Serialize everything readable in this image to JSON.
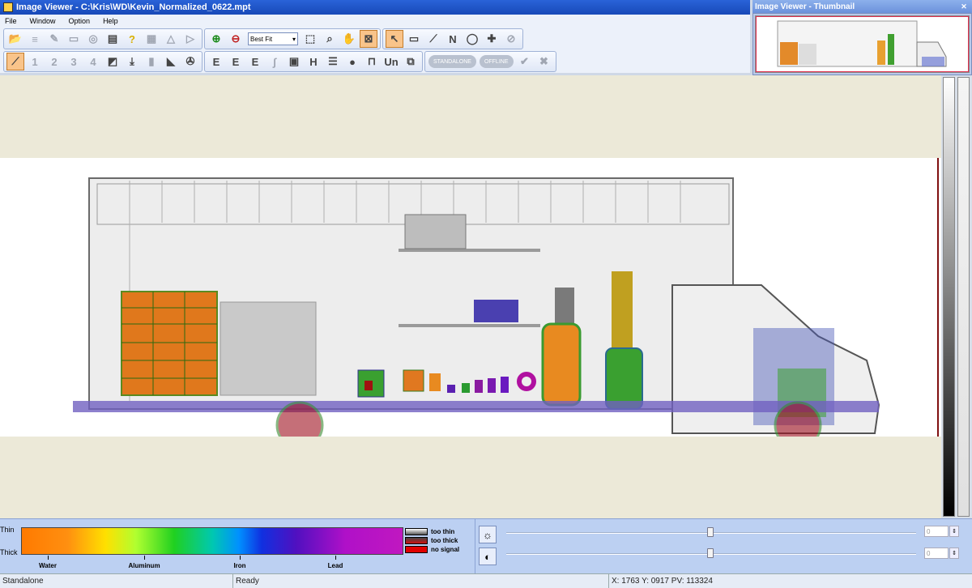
{
  "window": {
    "title": "Image Viewer - C:\\Kris\\WD\\Kevin_Normalized_0622.mpt",
    "thumb_title": "Image Viewer - Thumbnail"
  },
  "menu": [
    "File",
    "Window",
    "Option",
    "Help"
  ],
  "toolbar": {
    "zoom_select": "Best Fit",
    "standalone_label": "STANDALONE",
    "offline_label": "OFFLINE",
    "second_row_numbers": [
      "1",
      "2",
      "3",
      "4"
    ],
    "letter_buttons": [
      "N",
      "E",
      "E",
      "E",
      "H",
      "Un"
    ]
  },
  "legend": {
    "thin": "Thin",
    "thick": "Thick",
    "materials": [
      "Water",
      "Aluminum",
      "Iron",
      "Lead"
    ],
    "signals": [
      "too thin",
      "too thick",
      "no signal"
    ]
  },
  "sliders": {
    "brightness_value": "0",
    "contrast_value": "0"
  },
  "status": {
    "mode": "Standalone",
    "state": "Ready",
    "coords": "X: 1763  Y: 0917  PV: 113324"
  }
}
